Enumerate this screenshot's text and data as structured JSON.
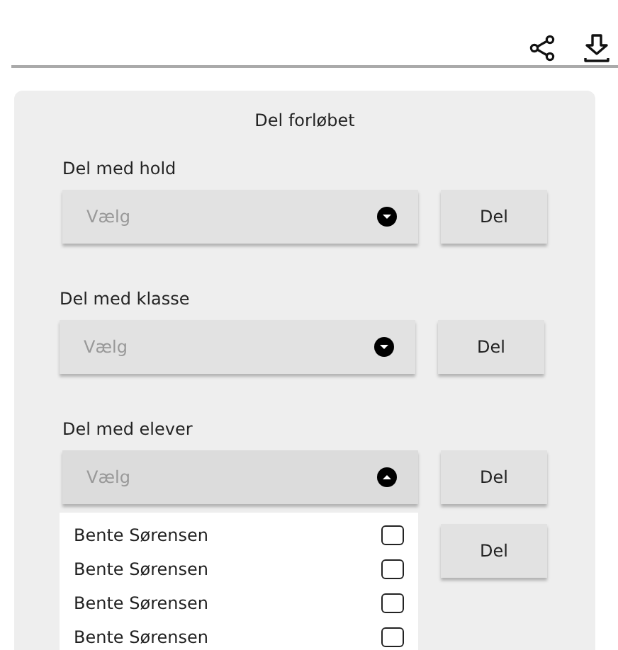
{
  "toolbar": {
    "buttons": [
      {
        "kind": "share"
      },
      {
        "kind": "download"
      }
    ]
  },
  "panel": {
    "title": "Del forløbet",
    "sections": [
      {
        "label": "Del med hold",
        "select": {
          "placeholder": "Vælg",
          "expanded": false
        },
        "button": "Del"
      },
      {
        "label": "Del med klasse",
        "select": {
          "placeholder": "Vælg",
          "expanded": false
        },
        "button": "Del"
      },
      {
        "label": "Del med elever",
        "select": {
          "placeholder": "Vælg",
          "expanded": true,
          "options": [
            {
              "label": "Bente Sørensen",
              "checked": false
            },
            {
              "label": "Bente Sørensen",
              "checked": false
            },
            {
              "label": "Bente Sørensen",
              "checked": false
            },
            {
              "label": "Bente Sørensen",
              "checked": false
            }
          ]
        },
        "button": "Del"
      }
    ],
    "extra_button": "Del"
  }
}
